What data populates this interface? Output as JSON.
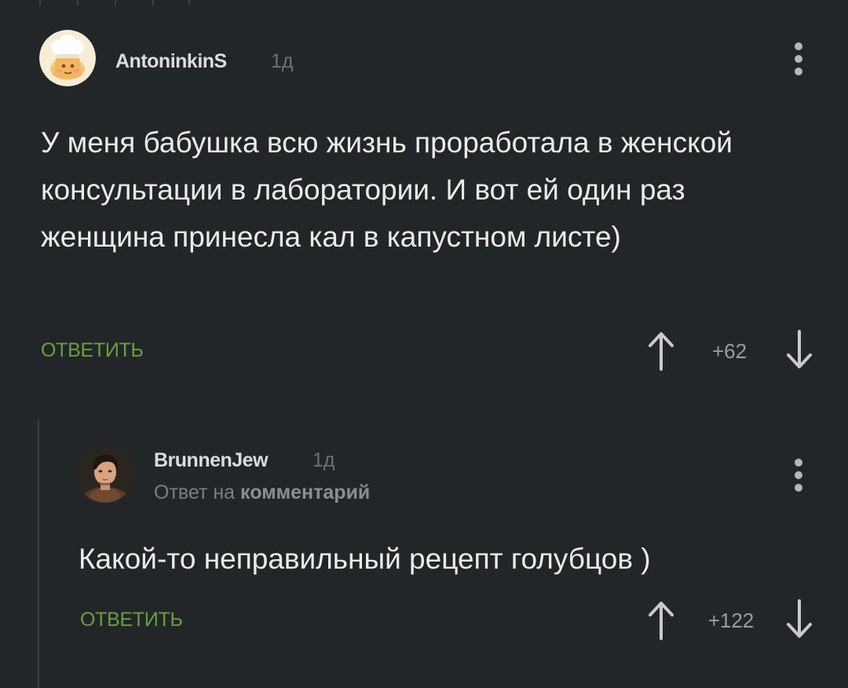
{
  "comments": [
    {
      "username": "AntoninkinS",
      "time": "1д",
      "text": "У меня бабушка всю жизнь проработала в женской консультации в лаборатории. И вот ей один раз женщина принесла кал в капустном листе)",
      "reply_label": "ОТВЕТИТЬ",
      "score": "+62",
      "avatar": "chef-avatar-icon"
    },
    {
      "username": "BrunnenJew",
      "time": "1д",
      "reply_prefix": "Ответ на",
      "reply_target": "комментарий",
      "text": "Какой-то неправильный рецепт голубцов )",
      "reply_label": "ОТВЕТИТЬ",
      "score": "+122",
      "avatar": "user-photo-avatar"
    }
  ],
  "colors": {
    "background": "#232629",
    "accent_green": "#6a9e3f",
    "muted": "#6d7175"
  }
}
